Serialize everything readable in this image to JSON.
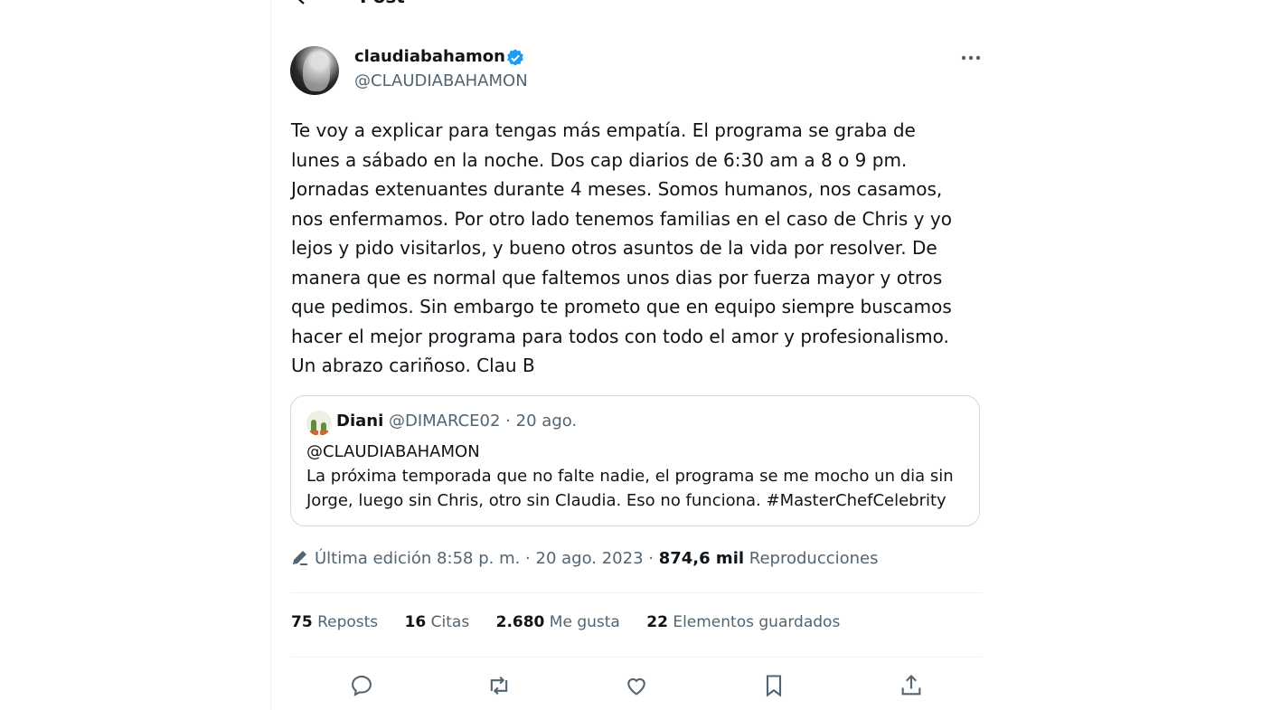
{
  "header": {
    "title": "Post"
  },
  "author": {
    "name": "claudiabahamon",
    "handle": "@CLAUDIABAHAMON"
  },
  "post": {
    "text": "Te voy a explicar para tengas más empatía. El programa se graba de\nlunes a sábado en la noche. Dos cap diarios de 6:30 am a 8 o 9 pm.\nJornadas extenuantes durante 4 meses. Somos humanos, nos casamos,\nnos enfermamos. Por otro lado tenemos familias en el caso de Chris y yo\nlejos y pido visitarlos, y bueno otros asuntos de la vida por resolver. De\nmanera que es normal que faltemos unos dias por fuerza mayor y otros\nque pedimos. Sin embargo te prometo que en equipo siempre buscamos\nhacer el mejor programa para todos con todo el amor y profesionalismo.\nUn abrazo cariñoso. Clau B"
  },
  "quote": {
    "name": "Diani",
    "handle": "@DIMARCE02",
    "date": "20 ago.",
    "mention": "@CLAUDIABAHAMON",
    "text": "La próxima temporada que no falte nadie, el programa se me mocho un dia sin\nJorge, luego sin Chris, otro sin Claudia. Eso no funciona. #MasterChefCelebrity"
  },
  "meta": {
    "edited": "Última edición 8:58 p. m. · 20 ago. 2023",
    "views_count": "874,6 mil",
    "views_label": "Reproducciones"
  },
  "stats": [
    {
      "count": "75",
      "label": "Reposts"
    },
    {
      "count": "16",
      "label": "Citas"
    },
    {
      "count": "2.680",
      "label": "Me gusta"
    },
    {
      "count": "22",
      "label": "Elementos guardados"
    }
  ],
  "colors": {
    "verified": "#1d9bf0",
    "secondary_text": "#536471",
    "border": "#cfd9de"
  },
  "icons": [
    "back-arrow-icon",
    "verified-badge-icon",
    "more-icon",
    "edit-icon",
    "reply-icon",
    "repost-icon",
    "like-icon",
    "bookmark-icon",
    "share-icon"
  ]
}
